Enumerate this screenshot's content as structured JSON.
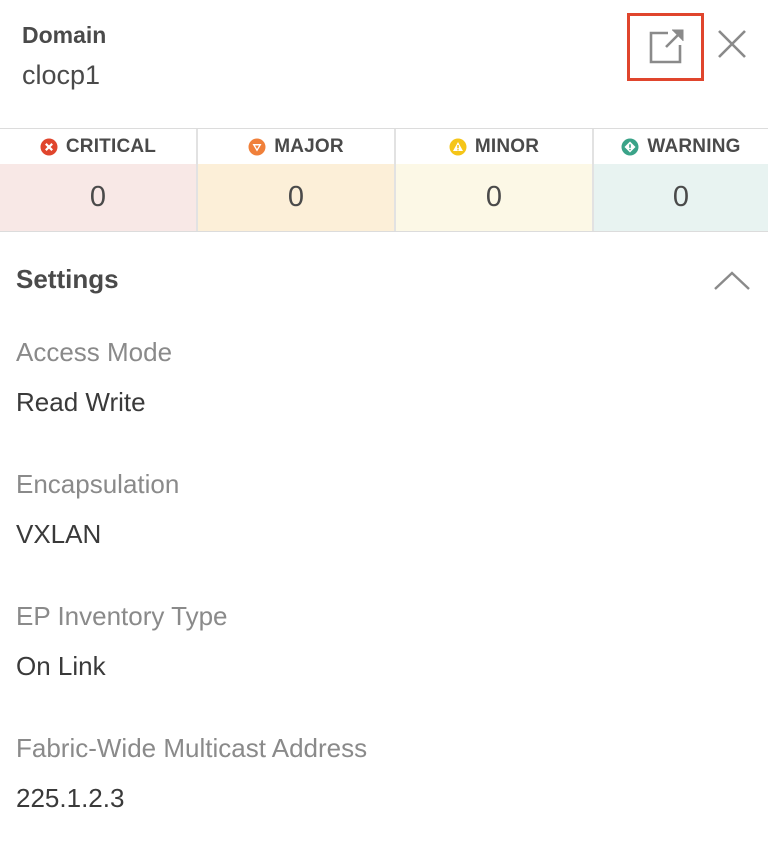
{
  "header": {
    "label": "Domain",
    "value": "clocp1",
    "open_icon": "open-in-new-window-icon",
    "close_icon": "close-icon"
  },
  "severity": [
    {
      "label": "CRITICAL",
      "count": "0",
      "icon": "critical-x-icon",
      "color": "#e0452d",
      "bg": "#f8e8e6"
    },
    {
      "label": "MAJOR",
      "count": "0",
      "icon": "major-down-triangle-icon",
      "color": "#f0803a",
      "bg": "#fcefd8"
    },
    {
      "label": "MINOR",
      "count": "0",
      "icon": "minor-warning-triangle-icon",
      "color": "#f5c518",
      "bg": "#fcf8e6"
    },
    {
      "label": "WARNING",
      "count": "0",
      "icon": "warning-exclamation-icon",
      "color": "#3aa388",
      "bg": "#e8f3f1"
    }
  ],
  "settings": {
    "title": "Settings",
    "collapse_icon": "chevron-up-icon",
    "fields": [
      {
        "label": "Access Mode",
        "value": "Read Write"
      },
      {
        "label": "Encapsulation",
        "value": "VXLAN"
      },
      {
        "label": "EP Inventory Type",
        "value": "On Link"
      },
      {
        "label": "Fabric-Wide Multicast Address",
        "value": "225.1.2.3"
      }
    ]
  }
}
